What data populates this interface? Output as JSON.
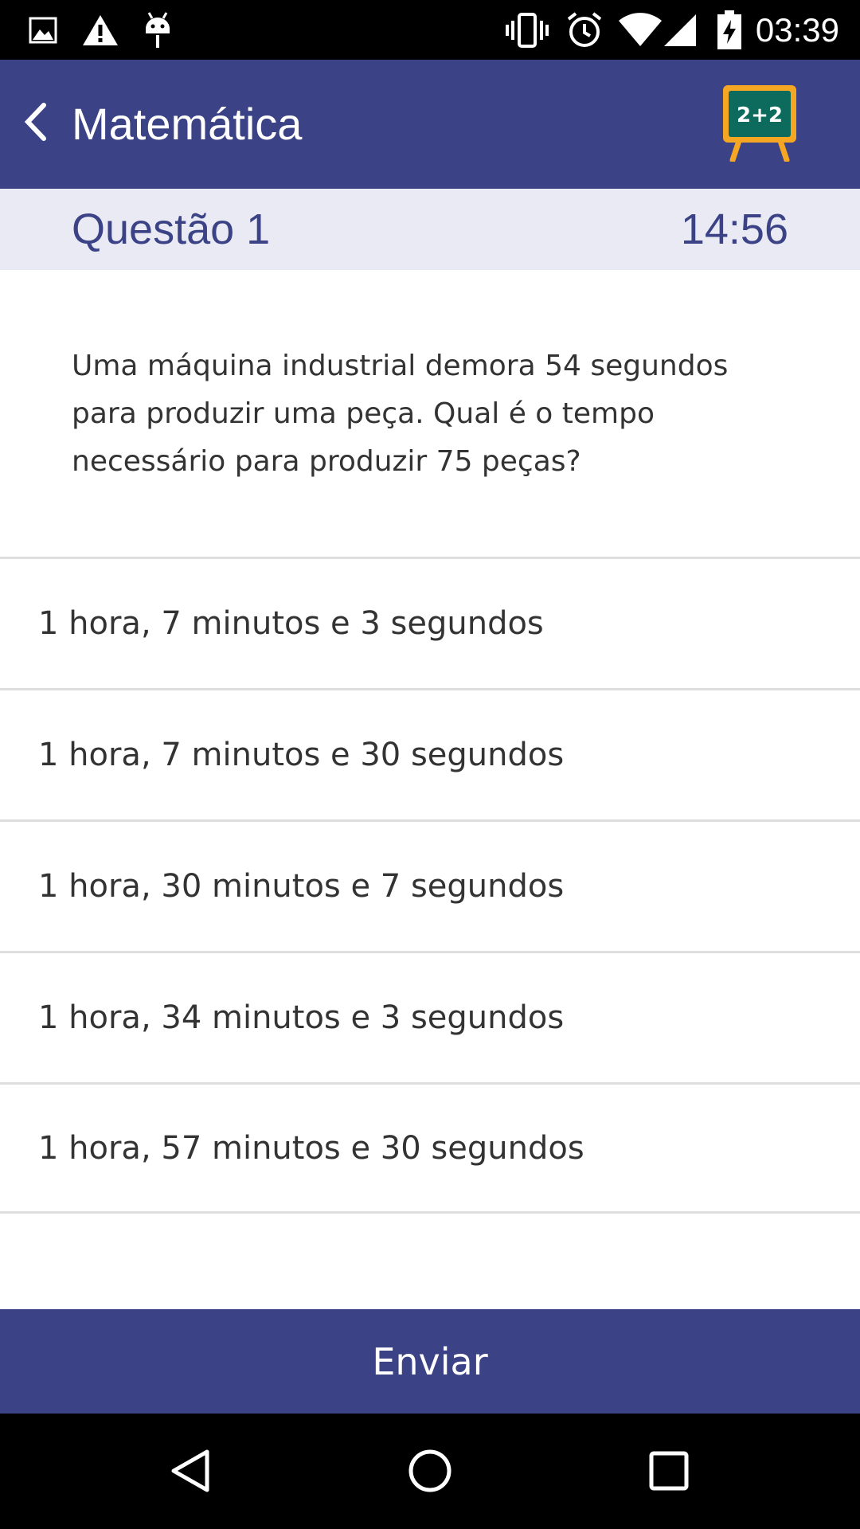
{
  "status_bar": {
    "time": "03:39",
    "icons": [
      "image-icon",
      "warning-icon",
      "android-icon",
      "vibrate-icon",
      "alarm-icon",
      "wifi-icon",
      "signal-icon",
      "battery-icon"
    ]
  },
  "app_bar": {
    "title": "Matemática",
    "logo_text": "2+2",
    "back_icon": "chevron-left-icon"
  },
  "question": {
    "title": "Questão 1",
    "timer": "14:56",
    "text": "Uma máquina industrial demora 54 segundos para produzir uma peça. Qual é o tempo necessário para produzir 75 peças?"
  },
  "options": [
    {
      "label": "1 hora, 7 minutos e 3 segundos"
    },
    {
      "label": "1 hora, 7 minutos e 30 segundos"
    },
    {
      "label": "1 hora, 30 minutos e 7 segundos"
    },
    {
      "label": "1 hora, 34 minutos e 3 segundos"
    },
    {
      "label": "1 hora, 57 minutos e 30 segundos"
    }
  ],
  "submit": {
    "label": "Enviar"
  },
  "nav_bar": {
    "icons": [
      "back-triangle-icon",
      "home-circle-icon",
      "recents-square-icon"
    ]
  },
  "colors": {
    "primary": "#3b4386",
    "header_bg": "#e9eaf4",
    "logo_frame": "#f5a623",
    "logo_board": "#0d6b5e"
  }
}
